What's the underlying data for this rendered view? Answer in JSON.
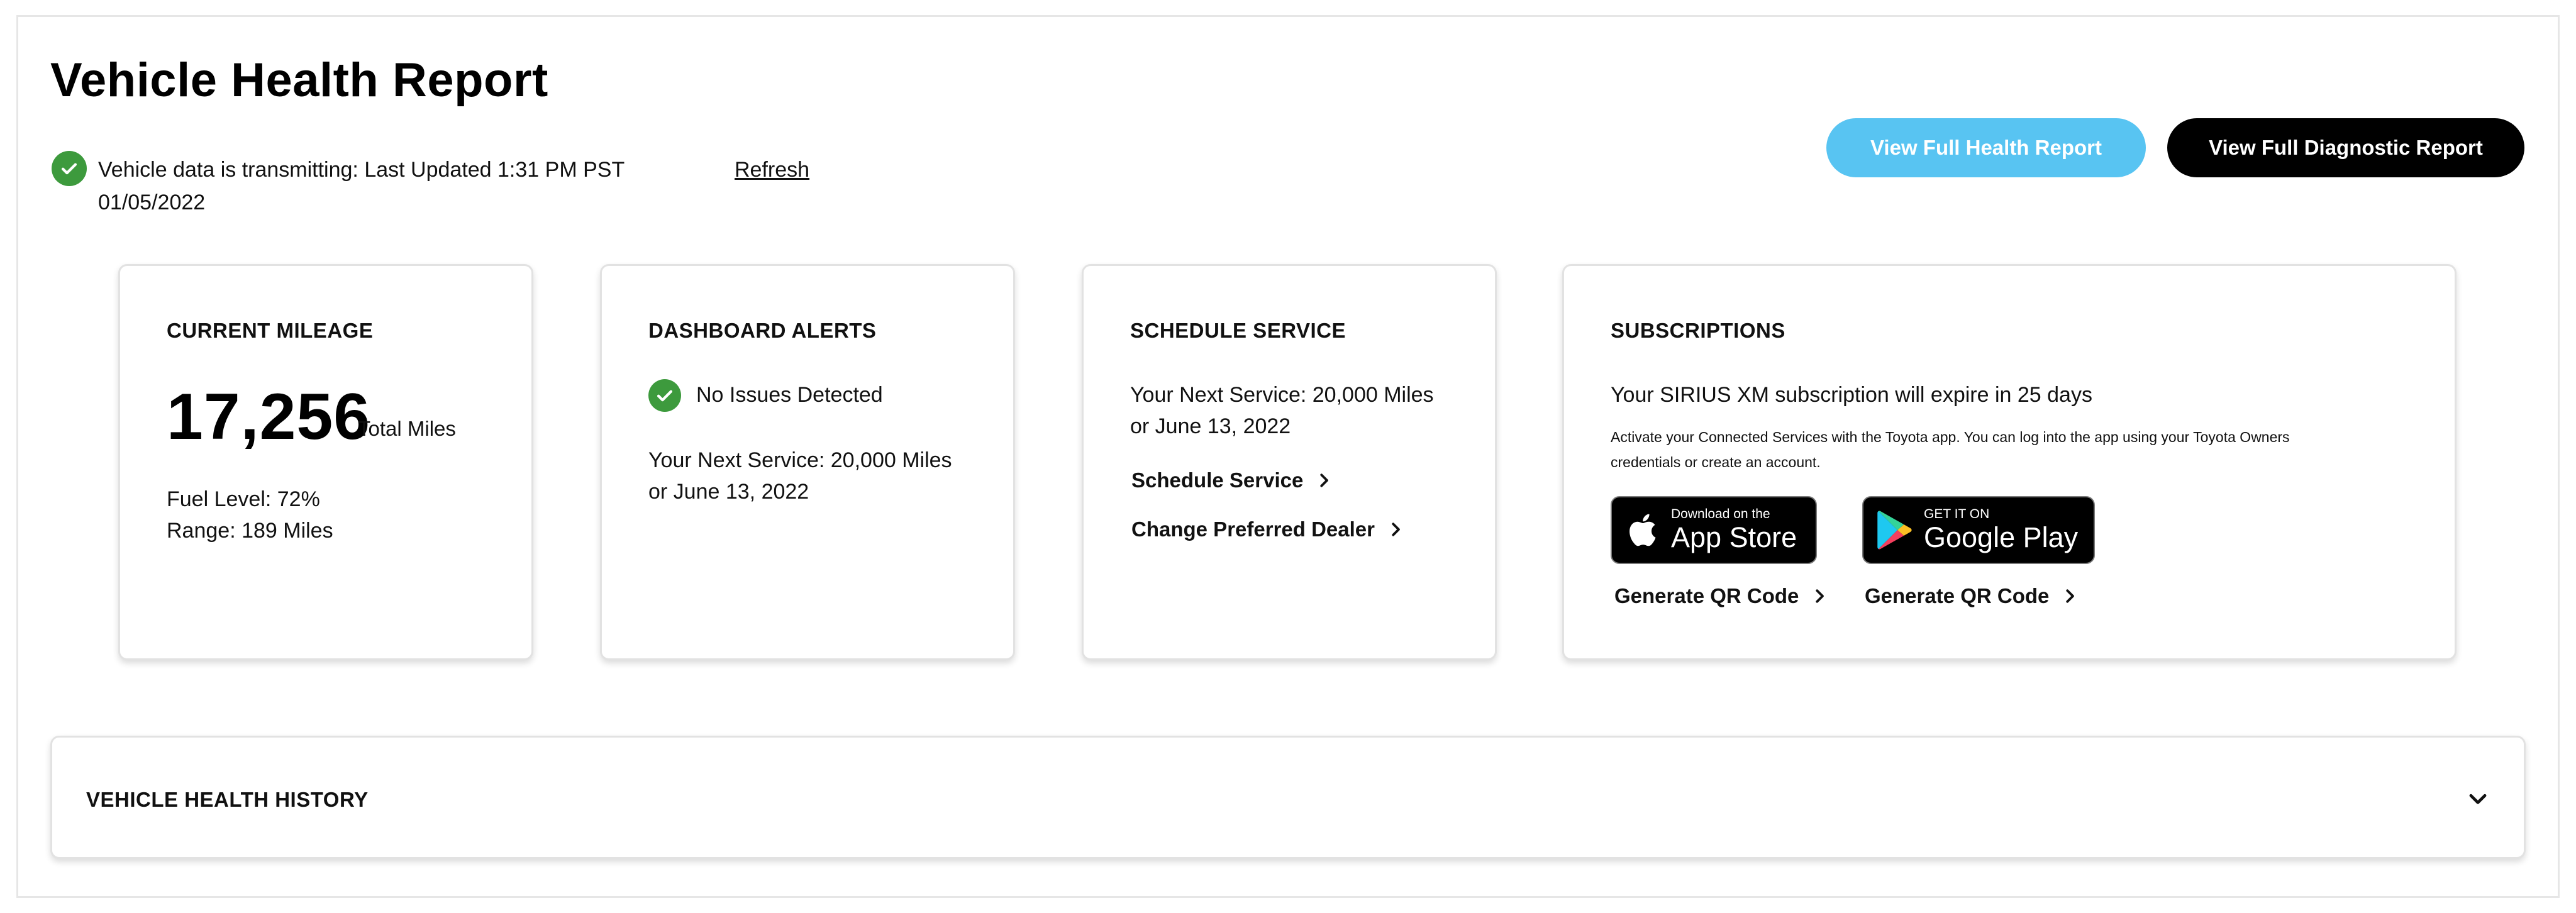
{
  "page": {
    "title": "Vehicle Health Report"
  },
  "status": {
    "text": "Vehicle data is transmitting: Last Updated 1:31 PM PST 01/05/2022",
    "refresh_label": "Refresh",
    "icon": "check-circle-icon",
    "color": "#3d9a3d"
  },
  "actions": {
    "health_report_label": "View Full Health Report",
    "health_report_color": "#58c4f2",
    "diagnostic_report_label": "View Full Diagnostic Report",
    "diagnostic_report_color": "#000000"
  },
  "cards": {
    "mileage": {
      "title": "CURRENT MILEAGE",
      "value": "17,256",
      "unit": "Total Miles",
      "fuel": "Fuel Level: 72%",
      "range": "Range: 189 Miles"
    },
    "alerts": {
      "title": "DASHBOARD ALERTS",
      "status": "No Issues Detected",
      "next_service_line1": "Your Next Service: 20,000 Miles",
      "next_service_line2": "or June 13, 2022"
    },
    "service": {
      "title": "SCHEDULE SERVICE",
      "next_service_line1": "Your Next Service: 20,000 Miles",
      "next_service_line2": "or June 13, 2022",
      "schedule_link": "Schedule Service",
      "dealer_link": "Change Preferred Dealer"
    },
    "subscriptions": {
      "title": "SUBSCRIPTIONS",
      "message": "Your SIRIUS XM subscription will expire in 25 days",
      "note_line1": "Activate your Connected Services with the Toyota app. You can log into the app using your Toyota Owners",
      "note_line2": "credentials or create an account.",
      "app_store": {
        "small": "Download on the",
        "big": "App Store",
        "icon": "apple-icon"
      },
      "google_play": {
        "small": "GET IT ON",
        "big": "Google Play",
        "icon": "google-play-icon"
      },
      "qr_link_1": "Generate QR Code",
      "qr_link_2": "Generate QR Code"
    }
  },
  "history": {
    "label": "VEHICLE HEALTH HISTORY",
    "icon": "chevron-down-icon"
  }
}
